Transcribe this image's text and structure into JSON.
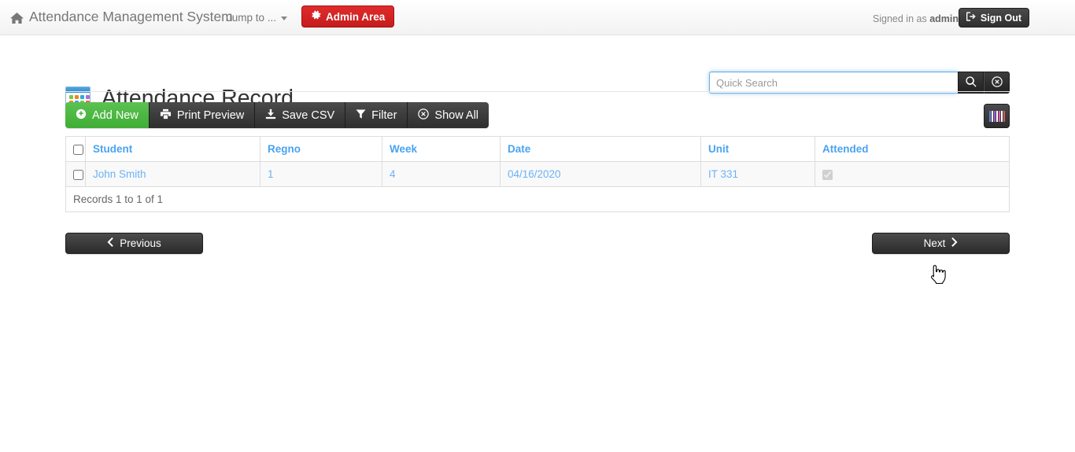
{
  "navbar": {
    "brand": "Attendance Management System",
    "brand_icon": "home-icon",
    "jump_to_label": "Jump to ...",
    "jump_to_icon": "chevron-down-icon",
    "admin_button": "Admin Area",
    "admin_icon": "gear-icon",
    "signed_in_prefix": "Signed in as ",
    "signed_in_user": "admin",
    "sign_out": "Sign Out",
    "sign_out_icon": "sign-out-icon",
    "admin_color": "#cc2222"
  },
  "page": {
    "title": "Attendance Record",
    "title_icon": "grid-table-icon"
  },
  "search": {
    "placeholder": "Quick Search",
    "value": "",
    "search_icon": "magnifier-icon",
    "clear_icon": "circle-x-icon"
  },
  "toolbar": {
    "buttons": [
      {
        "label": "Add New",
        "icon": "plus-circle-icon",
        "style": "green"
      },
      {
        "label": "Print Preview",
        "icon": "printer-icon",
        "style": "dark"
      },
      {
        "label": "Save CSV",
        "icon": "download-icon",
        "style": "dark"
      },
      {
        "label": "Filter",
        "icon": "funnel-icon",
        "style": "dark"
      },
      {
        "label": "Show All",
        "icon": "circle-x-icon",
        "style": "dark"
      }
    ],
    "columns_button_icon": "columns-icon",
    "add_new_color": "#45b13a"
  },
  "table": {
    "headers": [
      "Student",
      "Regno",
      "Week",
      "Date",
      "Unit",
      "Attended"
    ],
    "rows": [
      {
        "selected": false,
        "student": "John Smith",
        "regno": "1",
        "week": "4",
        "date": "04/16/2020",
        "unit": "IT 331",
        "attended": true
      }
    ],
    "footer": "Records 1 to 1 of 1",
    "header_link_color": "#4aa3f0"
  },
  "pagination": {
    "previous": "Previous",
    "previous_icon": "chevron-left-icon",
    "next": "Next",
    "next_icon": "chevron-right-icon"
  },
  "cursor": {
    "icon": "pointer-hand-cursor"
  }
}
